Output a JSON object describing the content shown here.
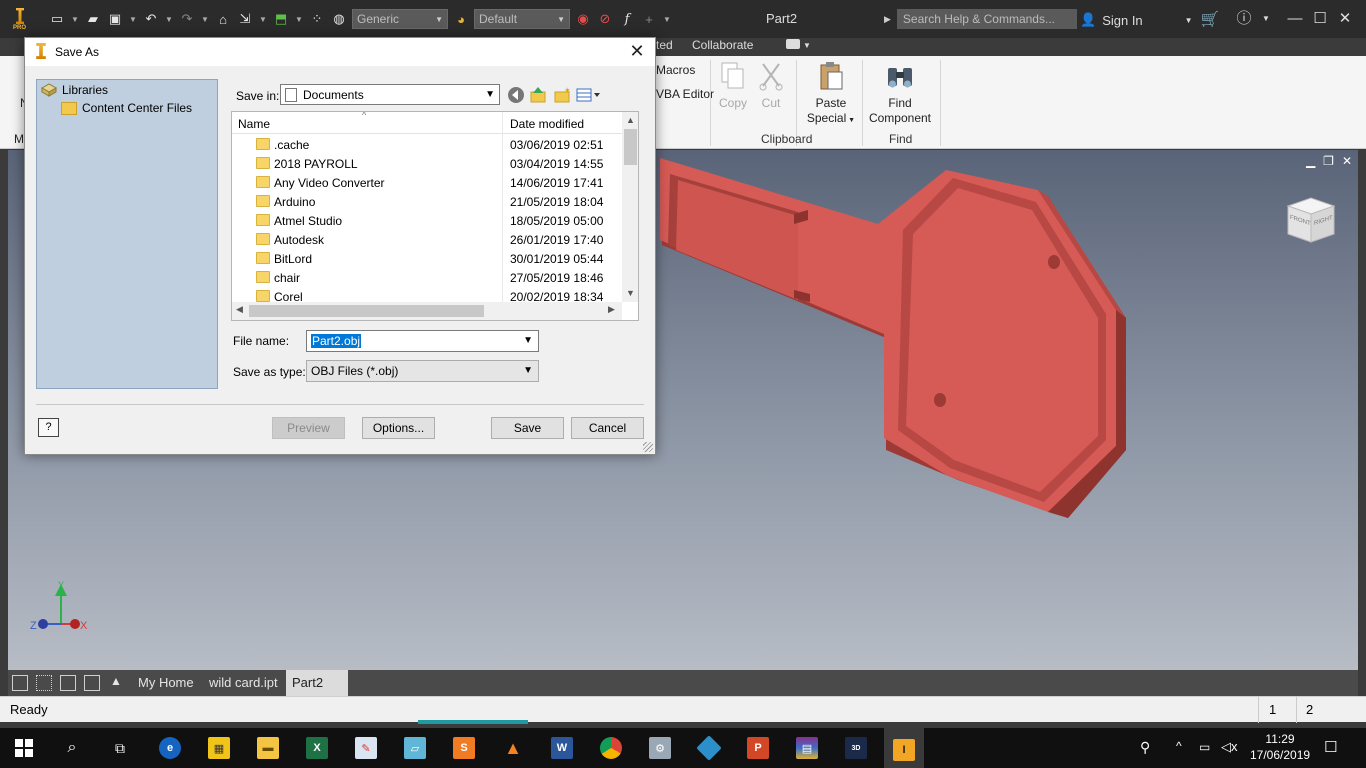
{
  "app": {
    "doc_title": "Part2",
    "search_placeholder": "Search Help & Commands...",
    "sign_in": "Sign In",
    "material_combo": "Generic",
    "appearance_combo": "Default",
    "logo_text": "PRO"
  },
  "ribbon": {
    "tabs": {
      "partial_left": "ted",
      "collaborate": "Collaborate"
    },
    "partial_items": {
      "macros": "Macros",
      "vba_editor": "VBA Editor",
      "left_m1": "N",
      "left_m2": "M"
    },
    "clipboard": {
      "copy": "Copy",
      "cut": "Cut",
      "paste_special_1": "Paste",
      "paste_special_2": "Special",
      "panel": "Clipboard"
    },
    "find": {
      "find_component_1": "Find",
      "find_component_2": "Component",
      "panel": "Find"
    }
  },
  "viewport": {
    "viewcube_front": "FRONT",
    "viewcube_right": "RIGHT",
    "axis_x": "X",
    "axis_y": "Y",
    "axis_z": "Z",
    "model_color": "#d9534f"
  },
  "doc_tabs": [
    {
      "label": "My Home"
    },
    {
      "label": "wild card.ipt"
    },
    {
      "label": "Part2",
      "close": "✕"
    }
  ],
  "status": {
    "text": "Ready",
    "num1": "1",
    "num2": "2"
  },
  "taskbar": {
    "time": "11:29",
    "date": "17/06/2019"
  },
  "dialog": {
    "title": "Save As",
    "libraries": "Libraries",
    "content_center": "Content Center Files",
    "save_in_label": "Save in:",
    "save_in_value": "Documents",
    "columns": {
      "name": "Name",
      "date": "Date modified"
    },
    "files": [
      {
        "name": ".cache",
        "date": "03/06/2019 02:51"
      },
      {
        "name": "2018 PAYROLL",
        "date": "03/04/2019 14:55"
      },
      {
        "name": "Any Video Converter",
        "date": "14/06/2019 17:41"
      },
      {
        "name": "Arduino",
        "date": "21/05/2019 18:04"
      },
      {
        "name": "Atmel Studio",
        "date": "18/05/2019 05:00"
      },
      {
        "name": "Autodesk",
        "date": "26/01/2019 17:40"
      },
      {
        "name": "BitLord",
        "date": "30/01/2019 05:44"
      },
      {
        "name": "chair",
        "date": "27/05/2019 18:46"
      },
      {
        "name": "Corel",
        "date": "20/02/2019 18:34"
      }
    ],
    "file_name_label": "File name:",
    "file_name_value": "Part2.obj",
    "save_as_type_label": "Save as type:",
    "save_as_type_value": "OBJ Files (*.obj)",
    "buttons": {
      "preview": "Preview",
      "options": "Options...",
      "save": "Save",
      "cancel": "Cancel",
      "help": "?"
    }
  }
}
